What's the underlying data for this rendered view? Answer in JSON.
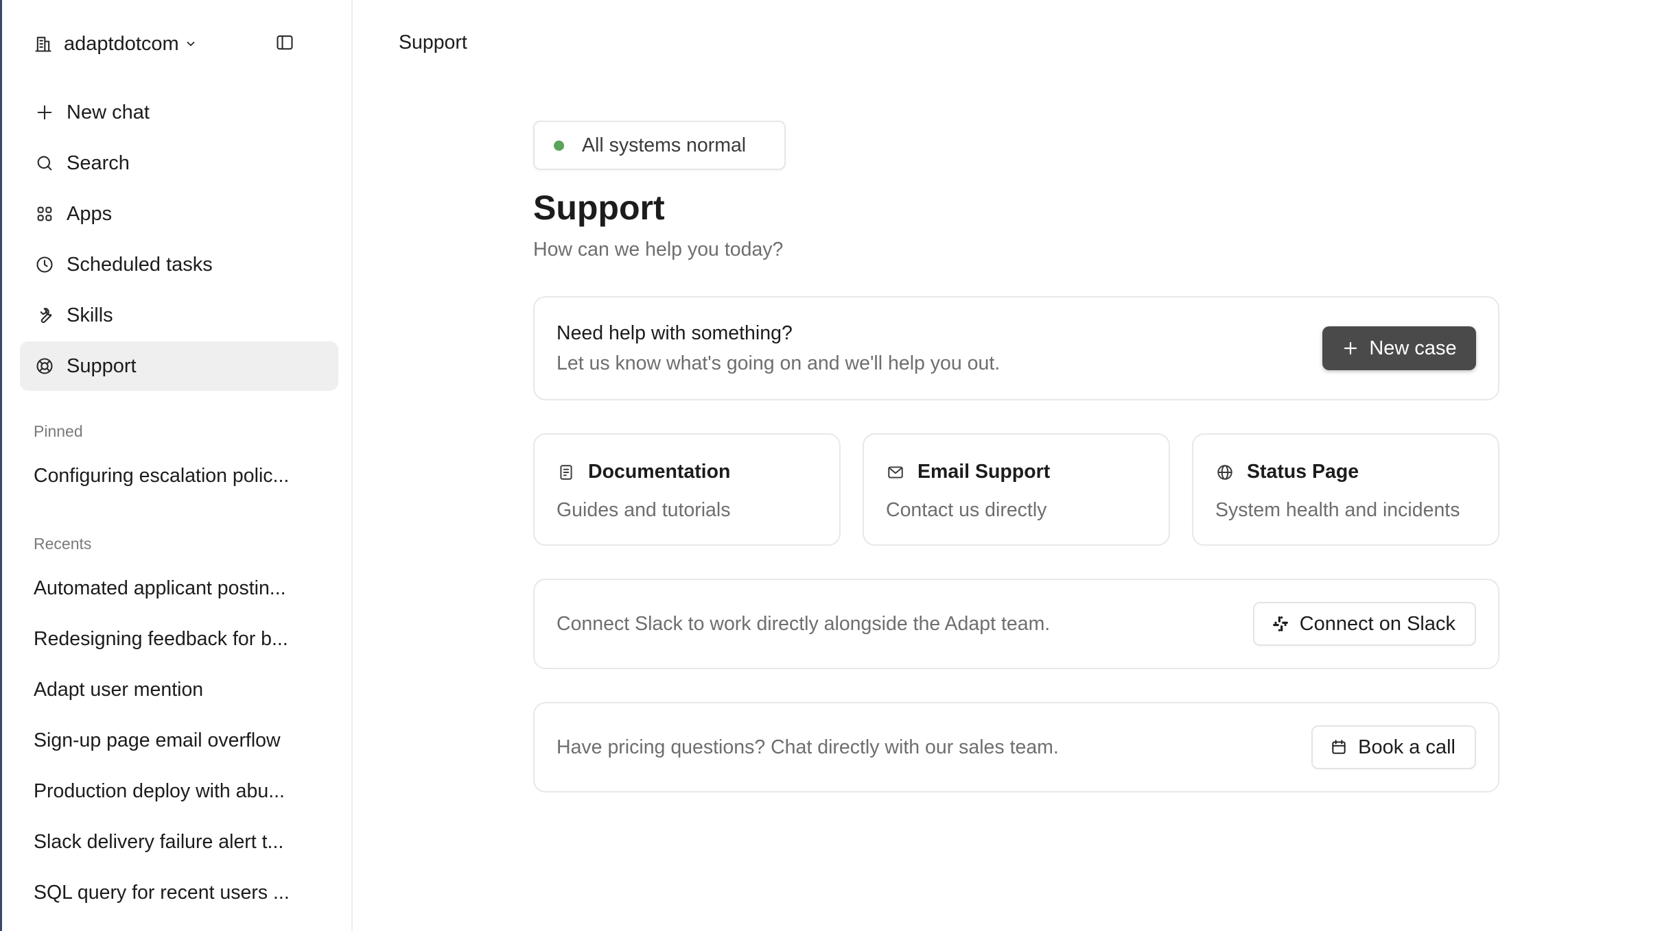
{
  "sidebar": {
    "workspace": {
      "name": "adaptdotcom",
      "icon": "building-icon"
    },
    "nav": [
      {
        "label": "New chat",
        "icon": "plus-icon",
        "active": false
      },
      {
        "label": "Search",
        "icon": "search-icon",
        "active": false
      },
      {
        "label": "Apps",
        "icon": "apps-grid-icon",
        "active": false
      },
      {
        "label": "Scheduled tasks",
        "icon": "clock-icon",
        "active": false
      },
      {
        "label": "Skills",
        "icon": "wrench-icon",
        "active": false
      },
      {
        "label": "Support",
        "icon": "lifebuoy-icon",
        "active": true
      }
    ],
    "pinned_label": "Pinned",
    "pinned": [
      "Configuring escalation polic..."
    ],
    "recents_label": "Recents",
    "recents": [
      "Automated applicant postin...",
      "Redesigning feedback for b...",
      "Adapt user mention",
      "Sign-up page email overflow",
      "Production deploy with abu...",
      "Slack delivery failure alert t...",
      "SQL query for recent users ..."
    ]
  },
  "topbar": {
    "title": "Support"
  },
  "main": {
    "status": {
      "text": "All systems normal",
      "color": "#5ca35c"
    },
    "title": "Support",
    "subtitle": "How can we help you today?",
    "help_card": {
      "title": "Need help with something?",
      "subtitle": "Let us know what's going on and we'll help you out.",
      "button_label": "New case"
    },
    "resources": [
      {
        "title": "Documentation",
        "subtitle": "Guides and tutorials",
        "icon": "document-icon"
      },
      {
        "title": "Email Support",
        "subtitle": "Contact us directly",
        "icon": "mail-icon"
      },
      {
        "title": "Status Page",
        "subtitle": "System health and incidents",
        "icon": "globe-icon"
      }
    ],
    "slack_card": {
      "text": "Connect Slack to work directly alongside the Adapt team.",
      "button_label": "Connect on Slack"
    },
    "call_card": {
      "text": "Have pricing questions? Chat directly with our sales team.",
      "button_label": "Book a call"
    }
  },
  "colors": {
    "accent_dark_button": "#4a4a4a",
    "active_nav_bg": "#efefef",
    "status_green": "#5ca35c"
  }
}
